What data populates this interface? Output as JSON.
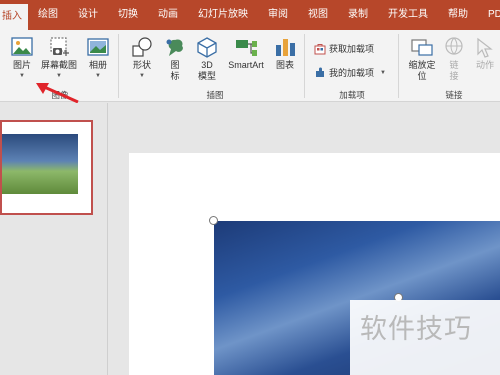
{
  "tabs": [
    "插入",
    "绘图",
    "设计",
    "切换",
    "动画",
    "幻灯片放映",
    "审阅",
    "视图",
    "录制",
    "开发工具",
    "帮助",
    "PDF"
  ],
  "ribbon": {
    "images_group": {
      "label": "图像",
      "picture": "图片",
      "screenshot": "屏幕截图",
      "album": "相册"
    },
    "illustrations_group": {
      "label": "插图",
      "shapes": "形状",
      "icons_line1": "图",
      "icons_line2": "标",
      "model3d_line1": "3D",
      "model3d_line2": "模型",
      "smartart": "SmartArt",
      "chart": "图表"
    },
    "addins_group": {
      "label": "加载项",
      "get_addins": "获取加载项",
      "my_addins": "我的加载项"
    },
    "links_group": {
      "label": "链接",
      "zoom_line1": "缩放定",
      "zoom_line2": "位",
      "link_line1": "链",
      "link_line2": "接",
      "action": "动作"
    }
  },
  "watermark": "软件技巧",
  "colors": {
    "accent": "#b7472a",
    "arrow": "#e0242a"
  }
}
